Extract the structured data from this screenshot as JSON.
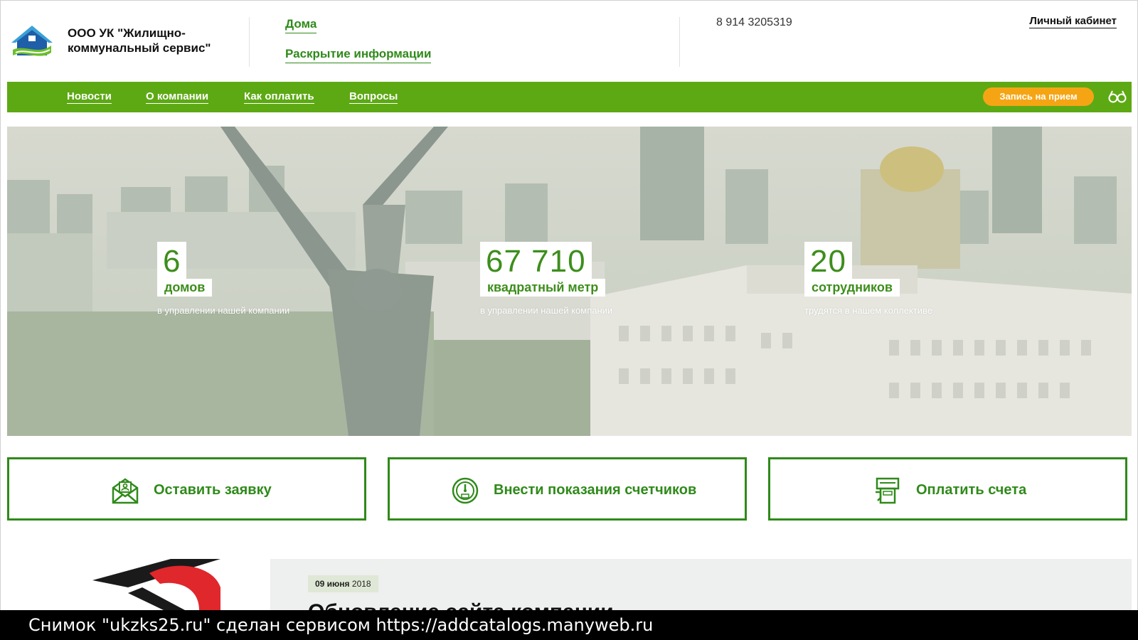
{
  "header": {
    "company_name": "ООО УК \"Жилищно-коммунальный сервис\"",
    "links": [
      "Дома",
      "Раскрытие информации"
    ],
    "phone": "8 914 3205319",
    "cabinet_link": "Личный кабинет"
  },
  "nav": {
    "items": [
      "Новости",
      "О компании",
      "Как оплатить",
      "Вопросы"
    ],
    "appointment_button": "Запись на прием",
    "accessibility_icon": "glasses-icon"
  },
  "stats": [
    {
      "value": "6",
      "label": "домов",
      "caption": "в управлении нашей компании"
    },
    {
      "value": "67 710",
      "label": "квадратный метр",
      "caption": "в управлении нашей компании"
    },
    {
      "value": "20",
      "label": "сотрудников",
      "caption": "трудятся в нашем коллективе"
    }
  ],
  "actions": [
    {
      "label": "Оставить заявку",
      "icon": "envelope-user-icon"
    },
    {
      "label": "Внести показания счетчиков",
      "icon": "meter-gauge-icon"
    },
    {
      "label": "Оплатить счета",
      "icon": "payment-terminal-icon"
    }
  ],
  "news": {
    "date_day": "09 июня",
    "date_year": "2018",
    "title": "Обновление сайта компании"
  },
  "caption": "Снимок \"ukzks25.ru\" сделан сервисом https://addcatalogs.manyweb.ru",
  "colors": {
    "brand_green": "#5da914",
    "text_green": "#2f8a1a",
    "accent_orange": "#f5a514"
  }
}
